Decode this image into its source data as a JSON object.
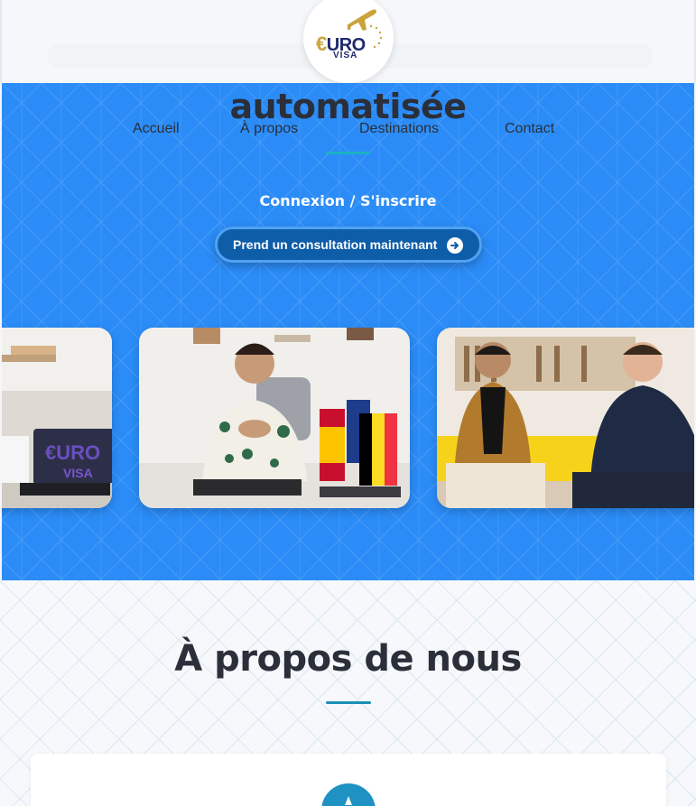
{
  "brand": {
    "logo_text_euro": "URO",
    "logo_text_euro_symbol": "€",
    "logo_text_visa": "VISA"
  },
  "hero": {
    "title": "automatisée",
    "nav": [
      "Accueil",
      "À propos",
      "Destinations",
      "Contact"
    ],
    "login_link": "Connexion / S'inscrire",
    "cta_label": "Prend un consultation maintenant",
    "video_logo_text": "€URO",
    "video_logo_sub": "VISA"
  },
  "about": {
    "title": "À propos de nous"
  },
  "colors": {
    "hero_bg": "#2b8cf7",
    "accent": "#1ab1c4",
    "cta": "#0e5da8",
    "text_dark": "#2b2f3a"
  }
}
